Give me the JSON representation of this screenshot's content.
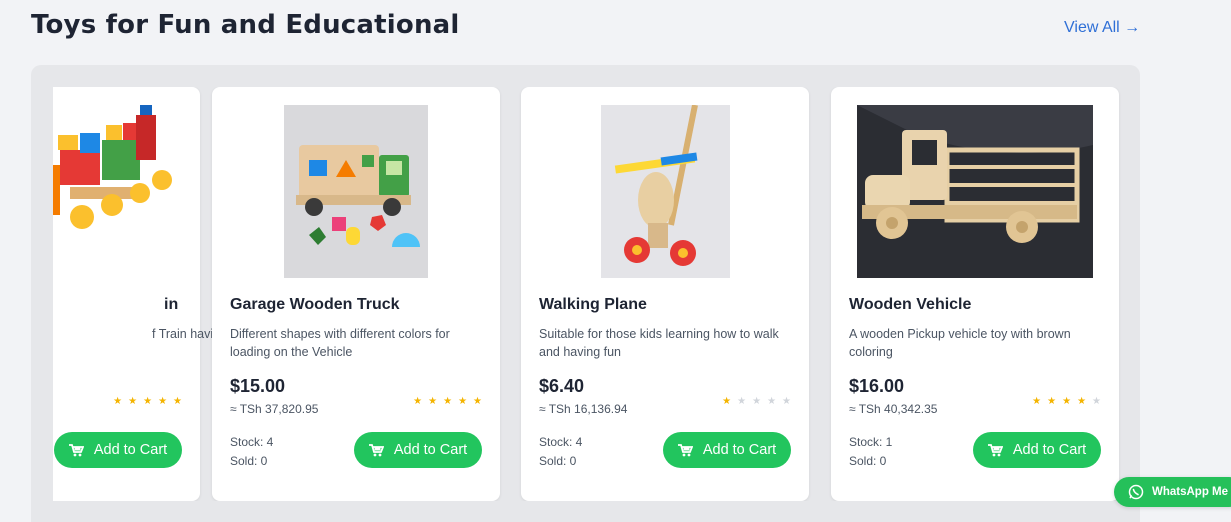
{
  "section": {
    "title": "Toys for Fun and Educational",
    "view_all": "View All →"
  },
  "products": [
    {
      "name": "in",
      "description": "f Train having Lods",
      "price": "",
      "local_price": "",
      "rating": 5,
      "stock": "",
      "sold": "",
      "cart_label": "Add to Cart",
      "image_icon": "toy-train-image"
    },
    {
      "name": "Garage Wooden Truck",
      "description": "Different shapes with different colors for loading on the Vehicle",
      "price": "$15.00",
      "local_price": "≈ TSh 37,820.95",
      "rating": 5,
      "stock": "Stock: 4",
      "sold": "Sold: 0",
      "cart_label": "Add to Cart",
      "image_icon": "shape-sorter-truck-image"
    },
    {
      "name": "Walking Plane",
      "description": "Suitable for those kids learning how to walk and having fun",
      "price": "$6.40",
      "local_price": "≈ TSh 16,136.94",
      "rating": 1,
      "stock": "Stock: 4",
      "sold": "Sold: 0",
      "cart_label": "Add to Cart",
      "image_icon": "push-plane-image"
    },
    {
      "name": "Wooden Vehicle",
      "description": "A wooden Pickup vehicle toy with brown coloring",
      "price": "$16.00",
      "local_price": "≈ TSh 40,342.35",
      "rating": 4,
      "stock": "Stock: 1",
      "sold": "Sold: 0",
      "cart_label": "Add to Cart",
      "image_icon": "wooden-pickup-image"
    }
  ],
  "whatsapp": {
    "label": "WhatsApp Me"
  },
  "colors": {
    "accent": "#22c55e",
    "link": "#2f6fd6",
    "star": "#f4b400"
  }
}
